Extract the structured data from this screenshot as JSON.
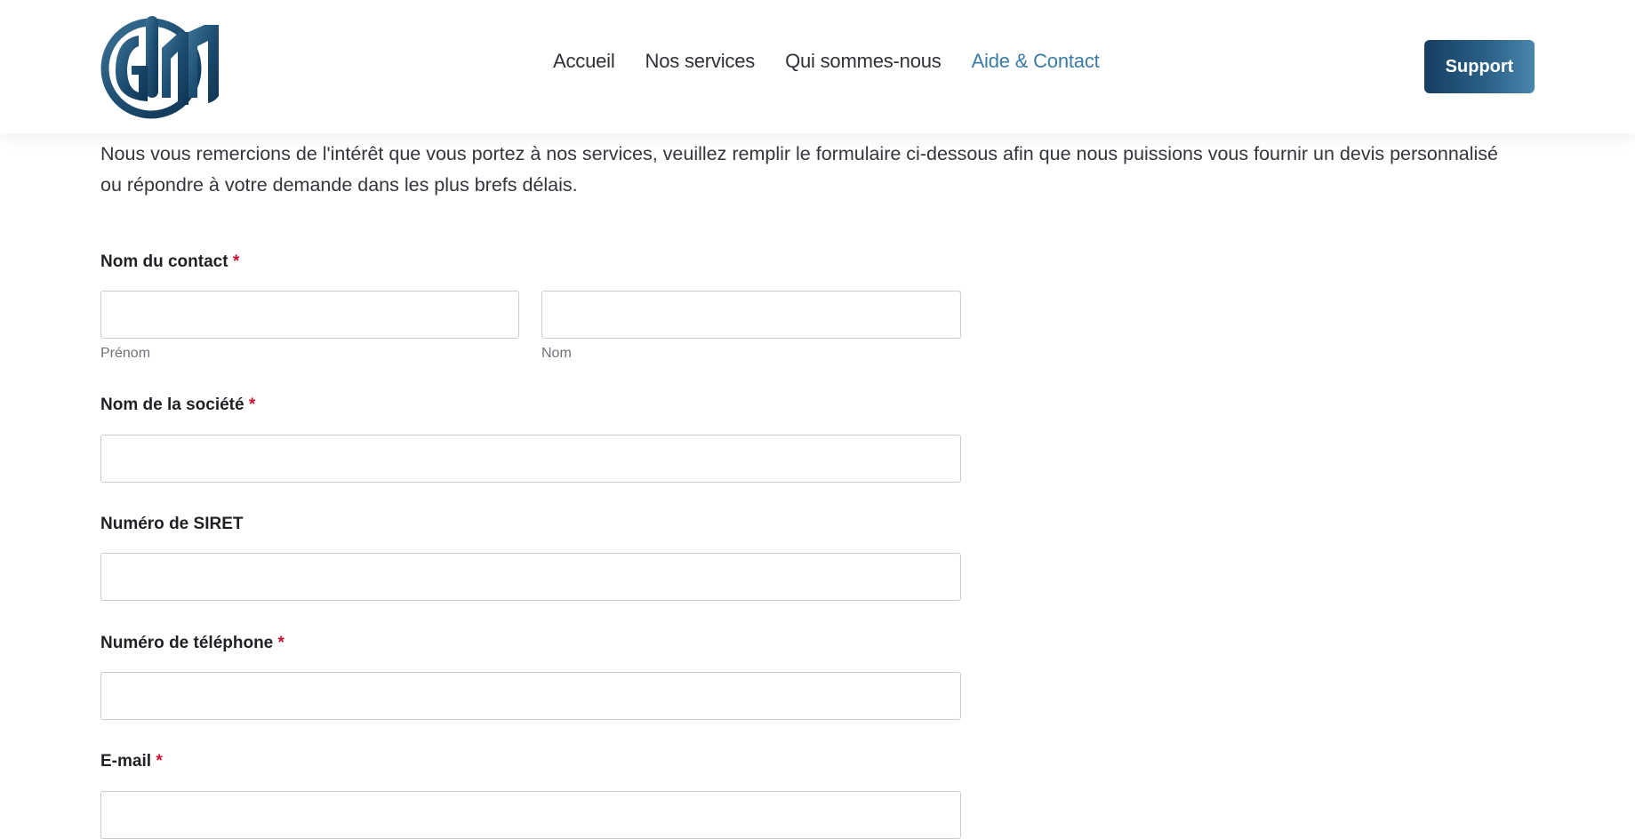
{
  "header": {
    "logo_text": "GIM",
    "nav": [
      {
        "label": "Accueil",
        "active": false
      },
      {
        "label": "Nos services",
        "active": false
      },
      {
        "label": "Qui sommes-nous",
        "active": false
      },
      {
        "label": "Aide & Contact",
        "active": true
      }
    ],
    "support_label": "Support"
  },
  "colors": {
    "brand_dark": "#163f62",
    "brand_light": "#4a86ad",
    "active_link": "#3a7ca5",
    "required": "#c8102e"
  },
  "intro_text": " Nous vous remercions de l'intérêt que vous portez à nos services, veuillez remplir le formulaire ci-dessous afin que nous puissions vous fournir un devis personnalisé ou répondre à votre demande dans les plus brefs délais.",
  "form": {
    "contact": {
      "label": "Nom du contact",
      "required_mark": "*",
      "first_name_sublabel": "Prénom",
      "first_name_value": "",
      "last_name_sublabel": "Nom",
      "last_name_value": ""
    },
    "company": {
      "label": "Nom de la société",
      "required_mark": "*",
      "value": ""
    },
    "siret": {
      "label": "Numéro de SIRET",
      "value": ""
    },
    "phone": {
      "label": "Numéro de téléphone",
      "required_mark": "*",
      "value": ""
    },
    "email": {
      "label": "E-mail",
      "required_mark": "*",
      "value": ""
    }
  }
}
